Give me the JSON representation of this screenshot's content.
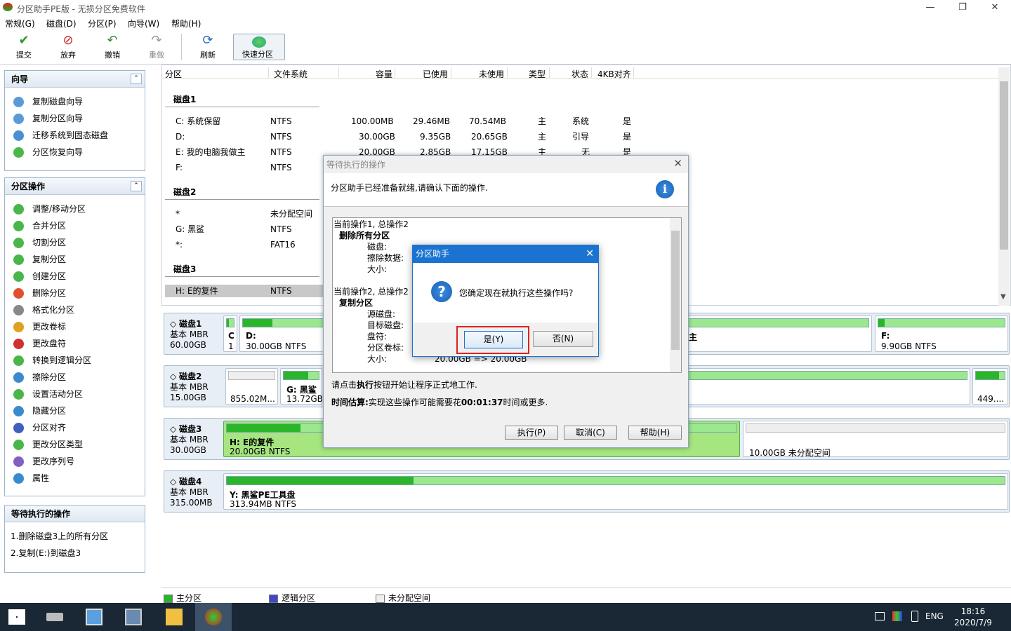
{
  "window": {
    "title": "分区助手PE版 - 无损分区免费软件"
  },
  "menu": [
    "常规(G)",
    "磁盘(D)",
    "分区(P)",
    "向导(W)",
    "帮助(H)"
  ],
  "toolbar": {
    "commit": "提交",
    "discard": "放弃",
    "undo": "撤销",
    "redo": "重做",
    "refresh": "刷新",
    "quick": "快速分区"
  },
  "wizard": {
    "title": "向导",
    "items": [
      "复制磁盘向导",
      "复制分区向导",
      "迁移系统到固态磁盘",
      "分区恢复向导"
    ]
  },
  "partops": {
    "title": "分区操作",
    "items": [
      "调整/移动分区",
      "合并分区",
      "切割分区",
      "复制分区",
      "创建分区",
      "删除分区",
      "格式化分区",
      "更改卷标",
      "更改盘符",
      "转换到逻辑分区",
      "擦除分区",
      "设置活动分区",
      "隐藏分区",
      "分区对齐",
      "更改分区类型",
      "更改序列号",
      "属性"
    ]
  },
  "pending": {
    "title": "等待执行的操作",
    "items": [
      "1.删除磁盘3上的所有分区",
      "2.复制(E:)到磁盘3"
    ]
  },
  "columns": [
    "分区",
    "文件系统",
    "容量",
    "已使用",
    "未使用",
    "类型",
    "状态",
    "4KB对齐"
  ],
  "groups": [
    "磁盘1",
    "磁盘2",
    "磁盘3"
  ],
  "rows_disk1": [
    {
      "p": "C: 系统保留",
      "fs": "NTFS",
      "cap": "100.00MB",
      "used": "29.46MB",
      "free": "70.54MB",
      "type": "主",
      "status": "系统",
      "align": "是"
    },
    {
      "p": "D:",
      "fs": "NTFS",
      "cap": "30.00GB",
      "used": "9.35GB",
      "free": "20.65GB",
      "type": "主",
      "status": "引导",
      "align": "是"
    },
    {
      "p": "E: 我的电脑我做主",
      "fs": "NTFS",
      "cap": "20.00GB",
      "used": "2.85GB",
      "free": "17.15GB",
      "type": "主",
      "status": "无",
      "align": "是"
    },
    {
      "p": "F:",
      "fs": "NTFS"
    }
  ],
  "rows_disk2": [
    {
      "p": "*",
      "fs": "未分配空间"
    },
    {
      "p": "G: 黑鲨",
      "fs": "NTFS"
    },
    {
      "p": "*:",
      "fs": "FAT16"
    }
  ],
  "rows_disk3": [
    {
      "p": "H: E的复件",
      "fs": "NTFS"
    }
  ],
  "disks": [
    {
      "name": "磁盘1",
      "type": "基本 MBR",
      "size": "60.00GB"
    },
    {
      "name": "磁盘2",
      "type": "基本 MBR",
      "size": "15.00GB"
    },
    {
      "name": "磁盘3",
      "type": "基本 MBR",
      "size": "30.00GB"
    },
    {
      "name": "磁盘4",
      "type": "基本 MBR",
      "size": "315.00MB"
    }
  ],
  "map": {
    "d1c": "C",
    "d1c_sz": "1",
    "d1d": "D:",
    "d1d_sz": "30.00GB NTFS",
    "d1e_tail": "主",
    "d1f": "F:",
    "d1f_sz": "9.90GB NTFS",
    "d2u_sz": "855.02M...",
    "d2g": "G: 黑鲨",
    "d2g_sz": "13.72GB",
    "d2x_sz": "449....",
    "d3h": "H: E的复件",
    "d3h_sz": "20.00GB NTFS",
    "d3u_sz": "10.00GB 未分配空间",
    "d4y": "Y: 黑鲨PE工具盘",
    "d4y_sz": "313.94MB NTFS"
  },
  "legend": {
    "primary": "主分区",
    "logical": "逻辑分区",
    "unalloc": "未分配空间"
  },
  "dialog1": {
    "title": "等待执行的操作",
    "message": "分区助手已经准备就绪,请确认下面的操作.",
    "lines": [
      "当前操作1, 总操作2",
      "删除所有分区",
      "磁盘:",
      "擦除数据:",
      "大小:",
      "当前操作2, 总操作2",
      "复制分区",
      "源磁盘:",
      "目标磁盘:",
      "盘符:",
      "分区卷标:",
      "大小:"
    ],
    "size_change": "20.00GB => 20.00GB",
    "hint_prefix": "请点击",
    "hint_bold": "执行",
    "hint_suffix": "按钮开始让程序正式地工作.",
    "est_label": "时间估算:",
    "est_prefix": "实现这些操作可能需要花",
    "est_time": "00:01:37",
    "est_suffix": "时间或更多.",
    "execute": "执行(P)",
    "cancel": "取消(C)",
    "help": "帮助(H)"
  },
  "dialog2": {
    "title": "分区助手",
    "message": "您确定现在就执行这些操作吗?",
    "yes": "是(Y)",
    "no": "否(N)"
  },
  "taskbar": {
    "lang": "ENG",
    "time": "18:16",
    "date": "2020/7/9"
  }
}
